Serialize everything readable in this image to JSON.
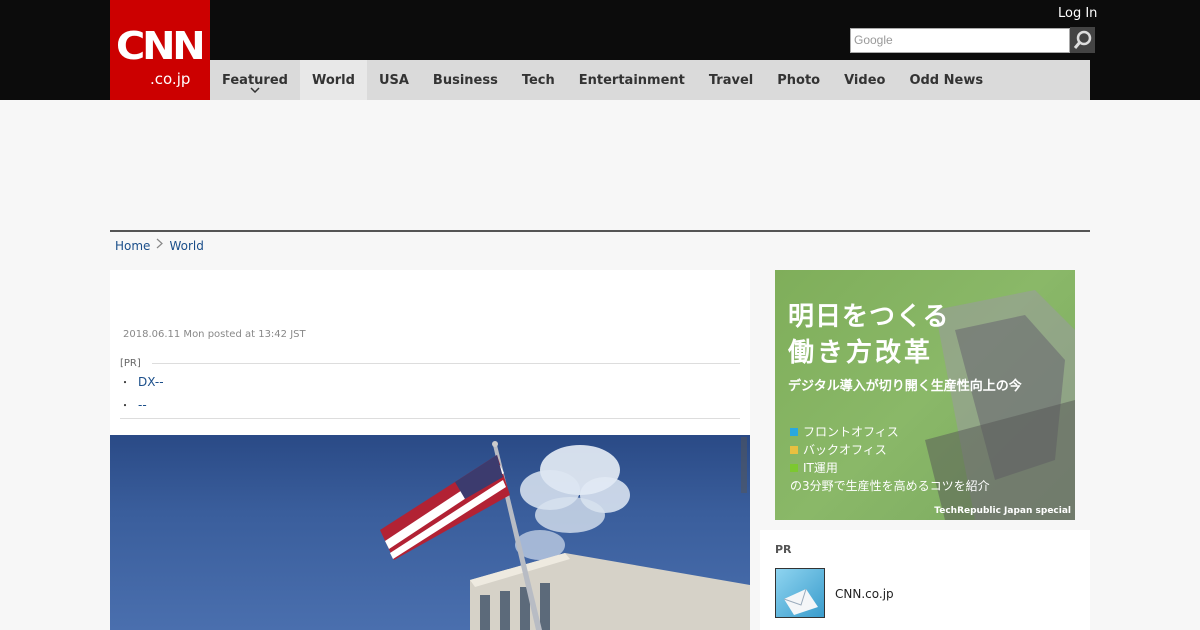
{
  "header": {
    "logo_text": "CNN",
    "logo_sub": ".co.jp",
    "login": "Log In",
    "search_placeholder": "Google"
  },
  "nav": [
    {
      "label": "Featured"
    },
    {
      "label": "World"
    },
    {
      "label": "USA"
    },
    {
      "label": "Business"
    },
    {
      "label": "Tech"
    },
    {
      "label": "Entertainment"
    },
    {
      "label": "Travel"
    },
    {
      "label": "Photo"
    },
    {
      "label": "Video"
    },
    {
      "label": "Odd News"
    }
  ],
  "breadcrumb": {
    "home": "Home",
    "section": "World"
  },
  "article": {
    "posted": "2018.06.11 Mon posted at 13:42 JST",
    "pr_label": "[PR]",
    "pr_links": [
      "DX--",
      "--"
    ]
  },
  "ad": {
    "line1": "明日をつくる",
    "line2": "働き方改革",
    "line3": "デジタル導入が切り開く生産性向上の今",
    "items": [
      {
        "text": "フロントオフィス",
        "color": "#29a8e0"
      },
      {
        "text": "バックオフィス",
        "color": "#e8c040"
      },
      {
        "text": "IT運用",
        "color": "#7cc830"
      }
    ],
    "line4": "の3分野で生産性を高めるコツを紹介",
    "footer": "TechRepublic Japan special"
  },
  "pr_box": {
    "heading": "PR",
    "name": "CNN.co.jp"
  },
  "colors": {
    "brand_red": "#cc0000",
    "link": "#1a4e8a"
  }
}
